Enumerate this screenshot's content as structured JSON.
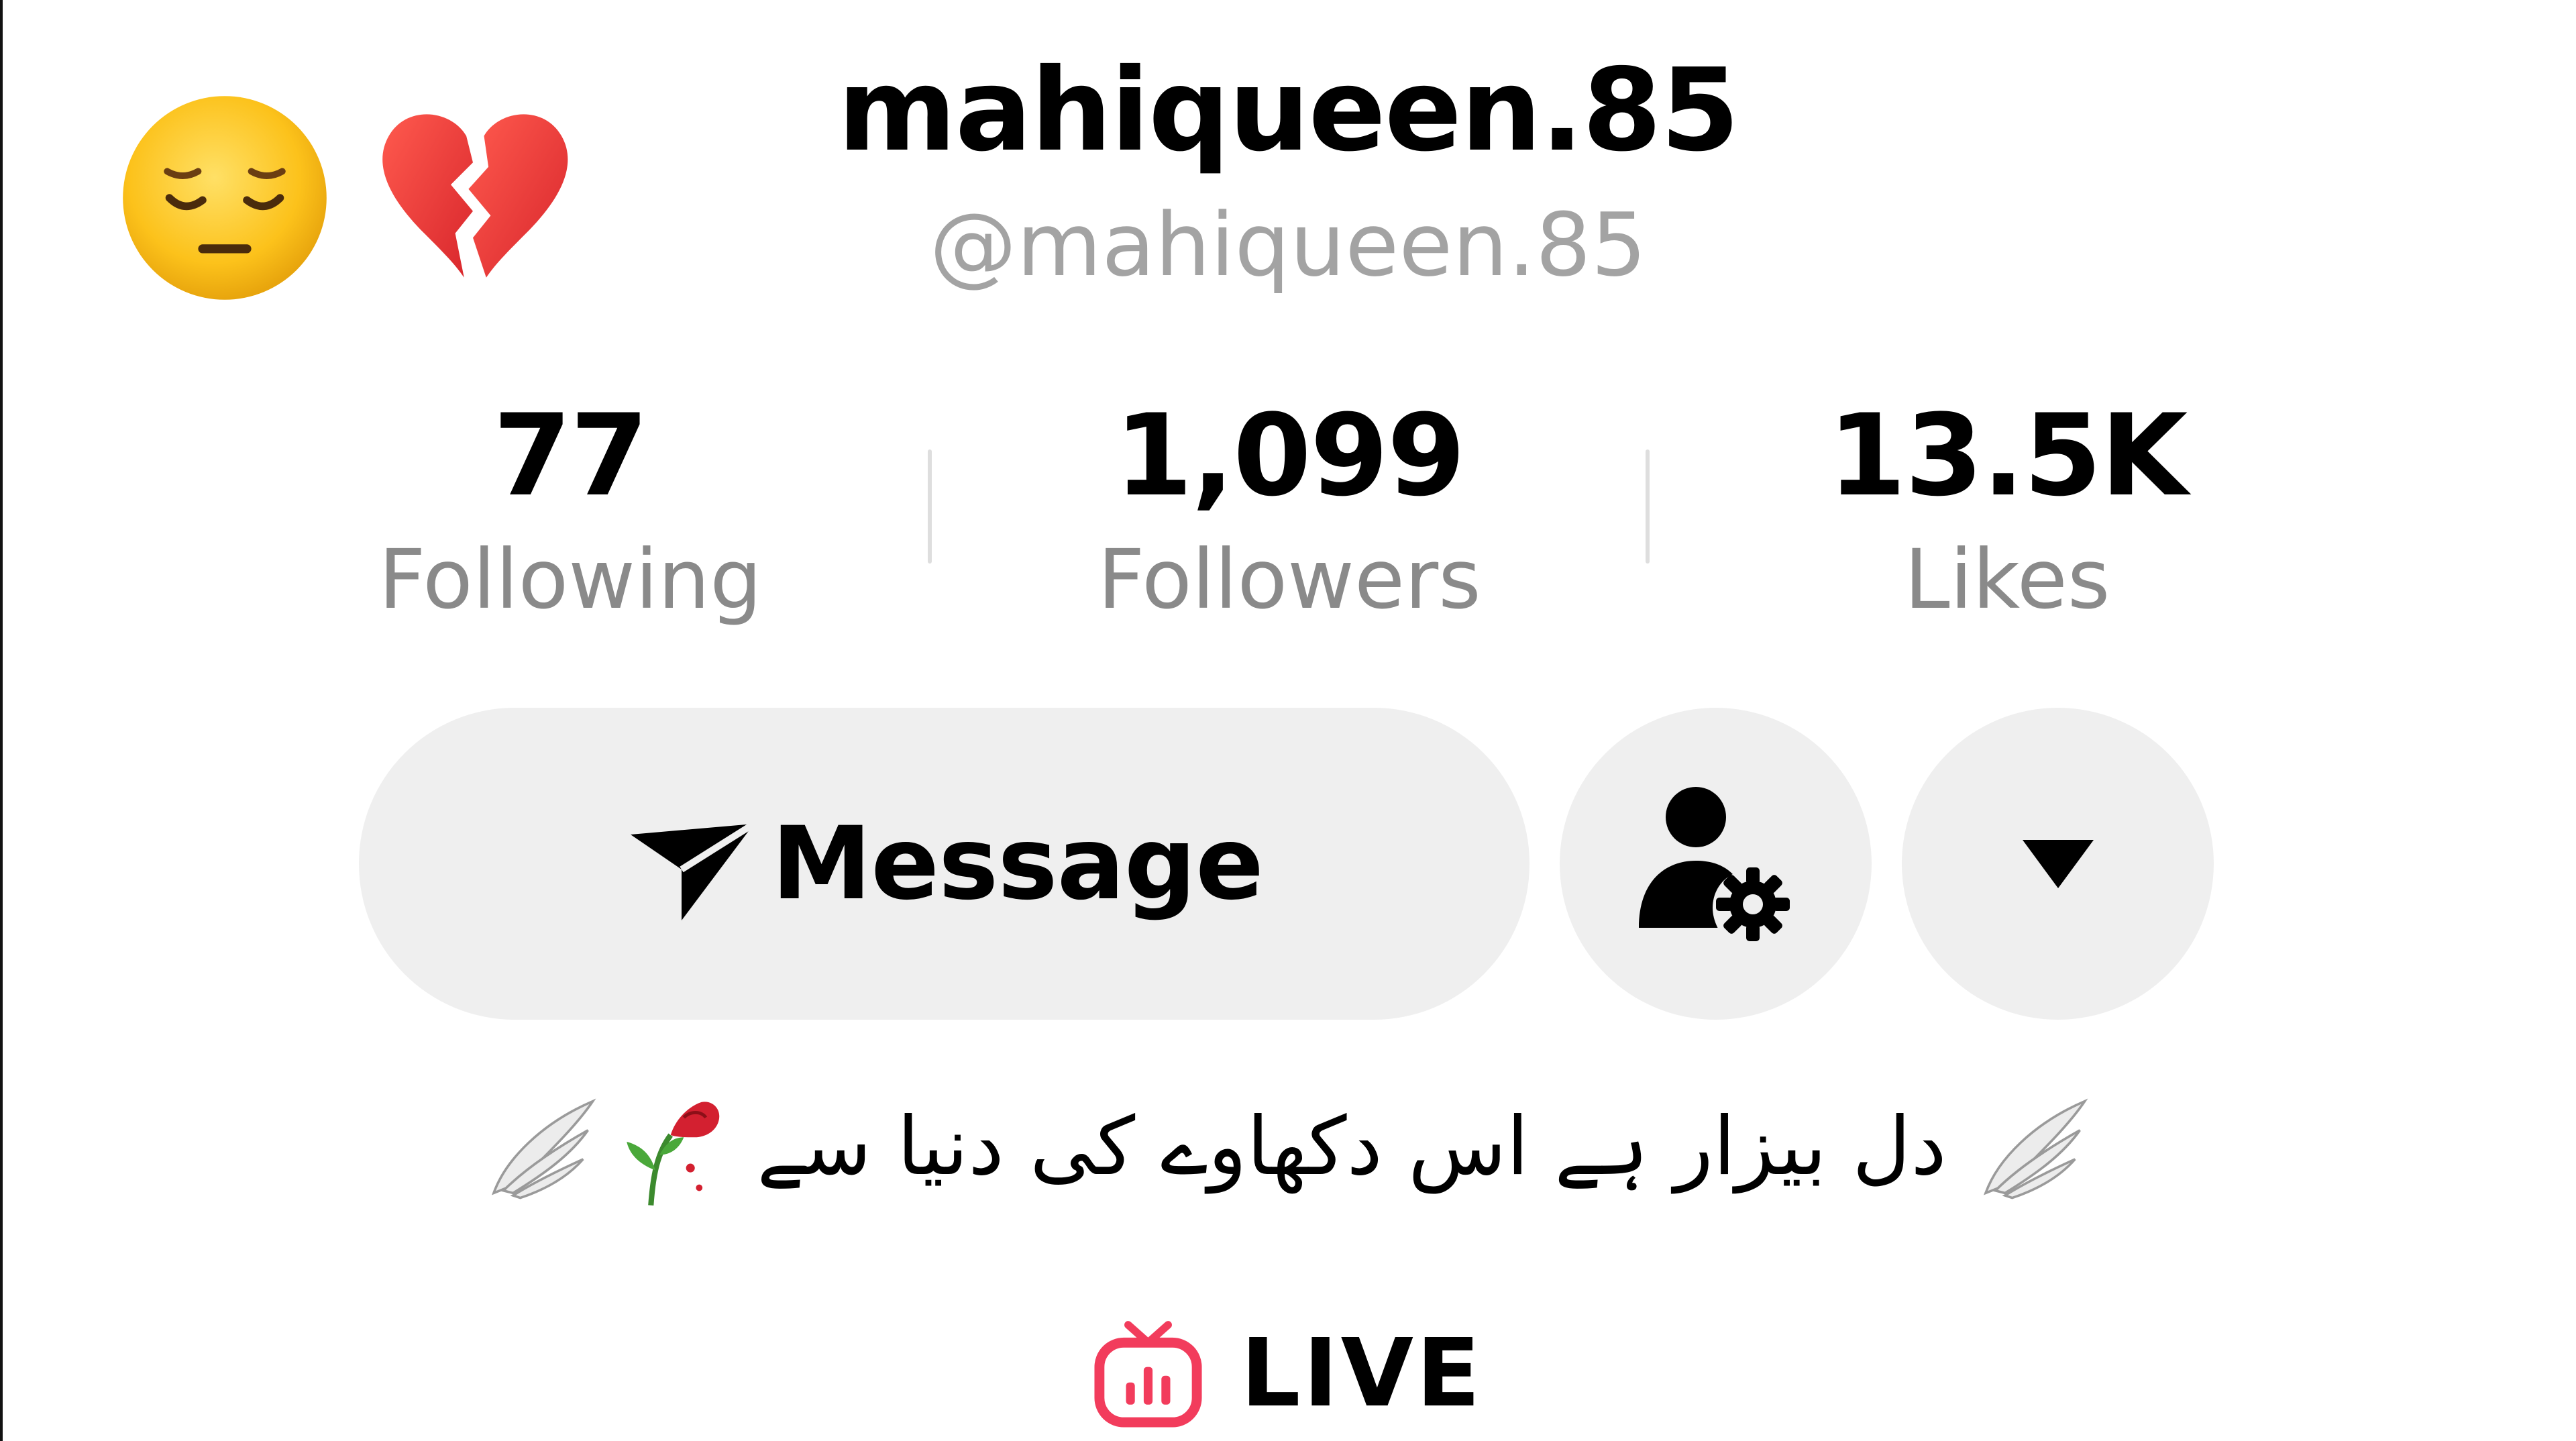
{
  "profile": {
    "username": "mahiqueen.85",
    "handle": "@mahiqueen.85",
    "decor_emoji": [
      "pensive-face",
      "broken-heart"
    ]
  },
  "stats": {
    "following": {
      "value": "77",
      "label": "Following"
    },
    "followers": {
      "value": "1,099",
      "label": "Followers"
    },
    "likes": {
      "value": "13.5K",
      "label": "Likes"
    }
  },
  "actions": {
    "message_label": "Message",
    "message_icon": "send-icon",
    "profile_settings_icon": "user-gear-icon",
    "more_icon": "caret-down-icon"
  },
  "bio": {
    "text": "دل بیزار ہے اس دکھاوے کی دنیا سے",
    "emoji": [
      "wing",
      "wilted-rose",
      "wing"
    ]
  },
  "live": {
    "label": "LIVE",
    "icon": "tv-live-icon",
    "accent_color": "#f23c5c"
  },
  "colors": {
    "button_bg": "#efefef",
    "secondary_text": "#8a8a8a",
    "handle_text": "#a3a3a3"
  }
}
